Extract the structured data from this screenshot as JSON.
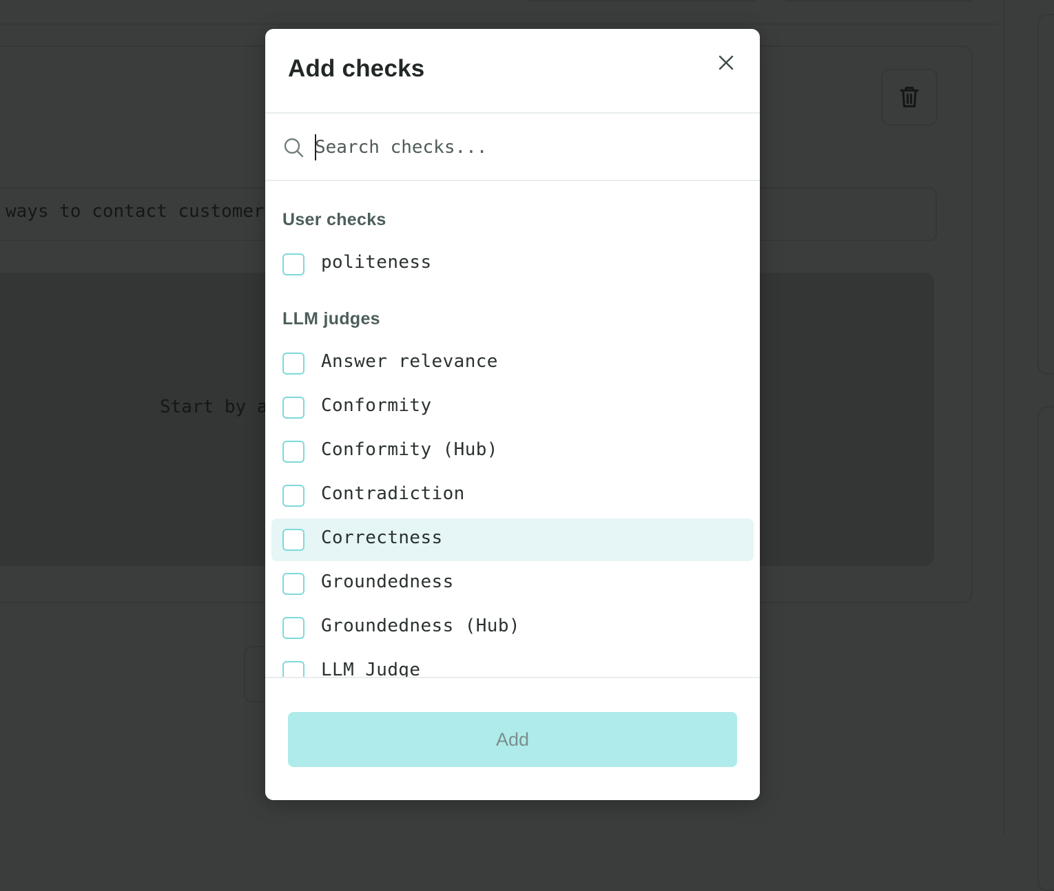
{
  "background": {
    "input_text": "ways to contact customer s",
    "empty_state_text": "Start by ad"
  },
  "modal": {
    "title": "Add checks",
    "close_icon": "close-icon",
    "search": {
      "placeholder": "Search checks...",
      "value": ""
    },
    "sections": [
      {
        "title": "User checks",
        "items": [
          {
            "label": "politeness",
            "checked": false
          }
        ]
      },
      {
        "title": "LLM judges",
        "items": [
          {
            "label": "Answer relevance",
            "checked": false
          },
          {
            "label": "Conformity",
            "checked": false
          },
          {
            "label": "Conformity (Hub)",
            "checked": false
          },
          {
            "label": "Contradiction",
            "checked": false
          },
          {
            "label": "Correctness",
            "checked": false,
            "hovered": true
          },
          {
            "label": "Groundedness",
            "checked": false
          },
          {
            "label": "Groundedness (Hub)",
            "checked": false
          },
          {
            "label": "LLM Judge",
            "checked": false
          }
        ]
      }
    ],
    "add_button_label": "Add"
  },
  "colors": {
    "overlay": "#3a3d3c",
    "checkbox_border": "#7fd9d9",
    "highlight_row": "#e6f5f6",
    "add_button_bg": "#b0ebeb",
    "add_button_text": "#7a8f8c"
  }
}
